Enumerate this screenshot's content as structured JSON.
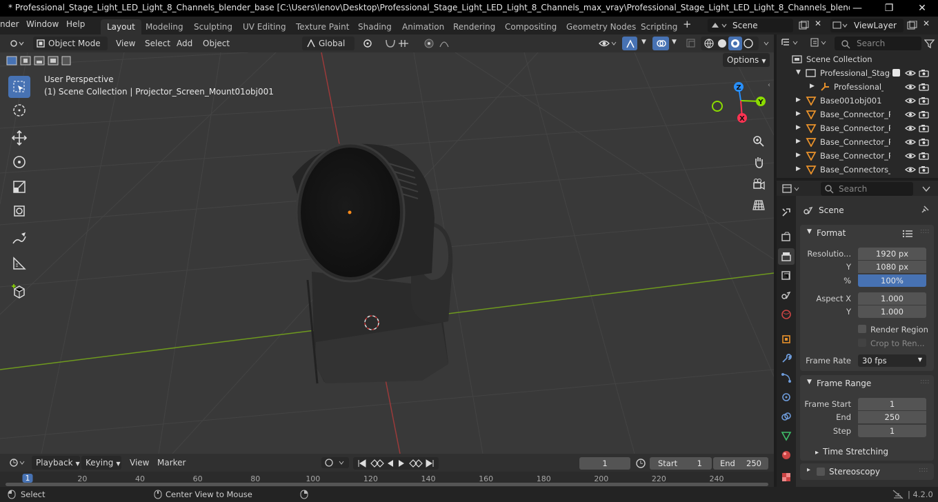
{
  "title": "* Professional_Stage_Light_LED_Light_8_Channels_blender_base [C:\\Users\\lenov\\Desktop\\Professional_Stage_Light_LED_Light_8_Channels_max_vray\\Professional_Stage_Light_LED_Light_8_Channels_blender_base.blend] - Blen…",
  "menu": [
    "nder",
    "Window",
    "Help"
  ],
  "workspaces": [
    "Layout",
    "Modeling",
    "Sculpting",
    "UV Editing",
    "Texture Paint",
    "Shading",
    "Animation",
    "Rendering",
    "Compositing",
    "Geometry Nodes",
    "Scripting"
  ],
  "scene_field": "Scene",
  "viewlayer_field": "ViewLayer",
  "viewport": {
    "mode": "Object Mode",
    "menus": [
      "View",
      "Select",
      "Add",
      "Object"
    ],
    "transform": "Global",
    "options": "Options",
    "info_line1": "User Perspective",
    "info_line2": "(1) Scene Collection | Projector_Screen_Mount01obj001",
    "axes": {
      "x": "X",
      "y": "Y",
      "z": "Z"
    }
  },
  "outliner": {
    "search_placeholder": "Search",
    "root": "Scene Collection",
    "items": [
      {
        "label": "Professional_Stage",
        "kind": "collection",
        "indent": 1
      },
      {
        "label": "Professional_St",
        "kind": "armature",
        "indent": 2
      },
      {
        "label": "Base001obj001",
        "kind": "mesh",
        "indent": 1
      },
      {
        "label": "Base_Connector_Pa",
        "kind": "mesh",
        "indent": 1
      },
      {
        "label": "Base_Connector_Pa",
        "kind": "mesh",
        "indent": 1
      },
      {
        "label": "Base_Connector_Pa",
        "kind": "mesh",
        "indent": 1
      },
      {
        "label": "Base_Connector_Pa",
        "kind": "mesh",
        "indent": 1
      },
      {
        "label": "Base_Connectors_I",
        "kind": "mesh",
        "indent": 1
      }
    ]
  },
  "properties": {
    "search_placeholder": "Search",
    "context": "Scene",
    "format": {
      "header": "Format",
      "res_x_label": "Resolutio...",
      "res_x": "1920 px",
      "res_y_label": "Y",
      "res_y": "1080 px",
      "pct_label": "%",
      "pct": "100%",
      "aspect_x_label": "Aspect X",
      "aspect_x": "1.000",
      "aspect_y_label": "Y",
      "aspect_y": "1.000",
      "render_region": "Render Region",
      "crop": "Crop to Ren...",
      "frame_rate_label": "Frame Rate",
      "frame_rate": "30 fps"
    },
    "frame_range": {
      "header": "Frame Range",
      "start_label": "Frame Start",
      "start": "1",
      "end_label": "End",
      "end": "250",
      "step_label": "Step",
      "step": "1"
    },
    "time_stretching": "Time Stretching",
    "stereoscopy": "Stereoscopy"
  },
  "timeline": {
    "menus": [
      "Playback",
      "Keying",
      "View",
      "Marker"
    ],
    "current_frame": "1",
    "start_label": "Start",
    "start": "1",
    "end_label": "End",
    "end": "250",
    "ruler": [
      "1",
      "20",
      "40",
      "60",
      "80",
      "100",
      "120",
      "140",
      "160",
      "180",
      "200",
      "220",
      "240"
    ]
  },
  "statusbar": {
    "select": "Select",
    "center": "Center View to Mouse",
    "version": "4.2.0"
  },
  "colors": {
    "accent": "#4772b3",
    "x_axis": "#ff3352",
    "y_axis": "#8bdc00",
    "z_axis": "#2890ff",
    "origin": "#ff8c1a"
  }
}
